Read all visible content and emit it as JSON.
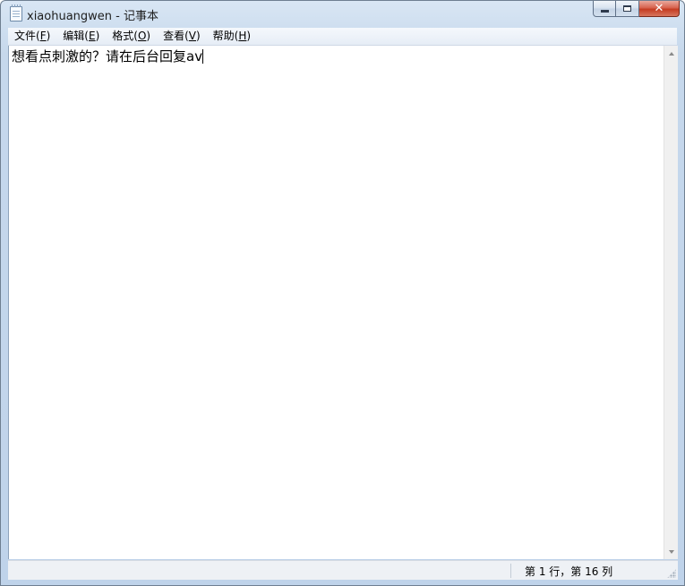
{
  "window": {
    "title": "xiaohuangwen - 记事本",
    "caption": {
      "minimize_icon": "minimize-icon",
      "maximize_icon": "maximize-icon",
      "close_icon": "close-icon",
      "close_glyph": "✕",
      "close_color": "#c43c22"
    }
  },
  "menu": {
    "items": [
      {
        "label": "文件(",
        "key": "F",
        "suffix": ")"
      },
      {
        "label": "编辑(",
        "key": "E",
        "suffix": ")"
      },
      {
        "label": "格式(",
        "key": "O",
        "suffix": ")"
      },
      {
        "label": "查看(",
        "key": "V",
        "suffix": ")"
      },
      {
        "label": "帮助(",
        "key": "H",
        "suffix": ")"
      }
    ]
  },
  "editor": {
    "content": "想看点刺激的？请在后台回复av"
  },
  "statusbar": {
    "position": "第 1 行，第 16 列"
  }
}
